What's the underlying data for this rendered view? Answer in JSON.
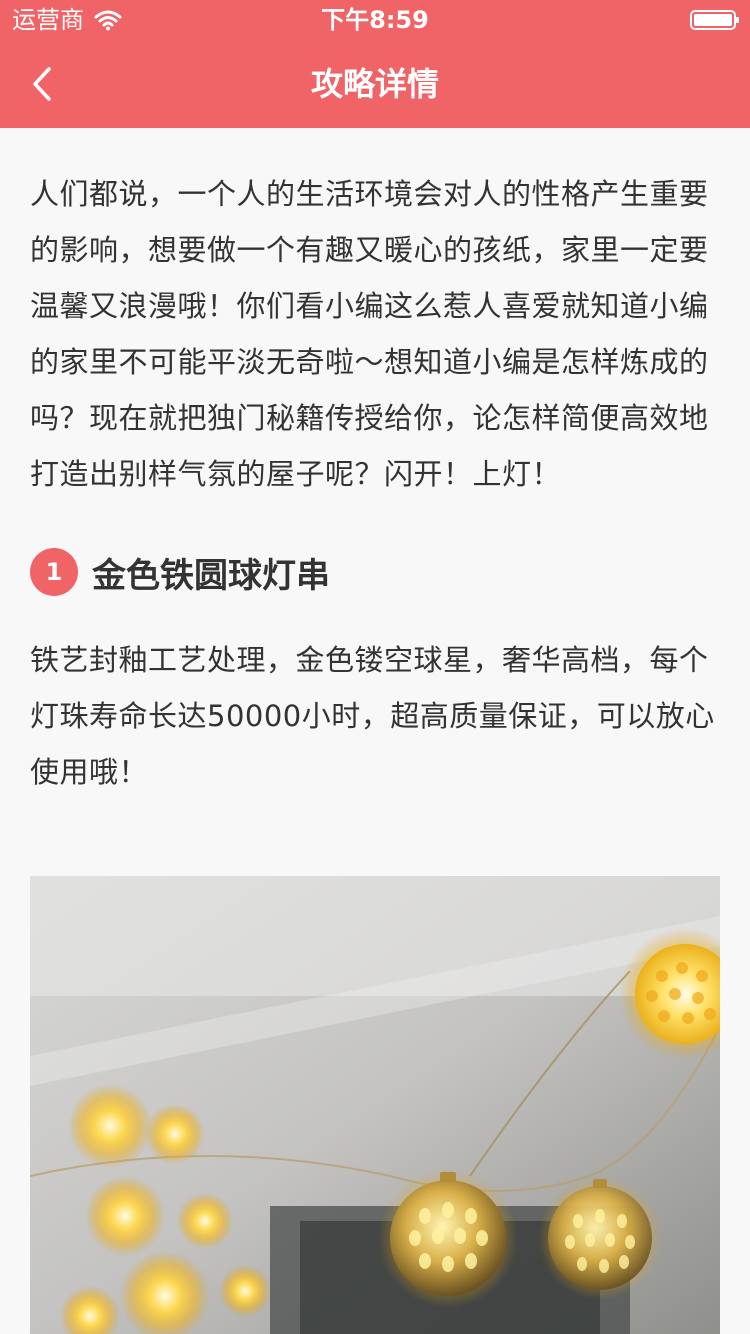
{
  "status_bar": {
    "carrier": "运营商",
    "time": "下午8:59"
  },
  "nav": {
    "title": "攻略详情"
  },
  "article": {
    "intro": "人们都说，一个人的生活环境会对人的性格产生重要的影响，想要做一个有趣又暖心的孩纸，家里一定要温馨又浪漫哦！你们看小编这么惹人喜爱就知道小编的家里不可能平淡无奇啦～想知道小编是怎样炼成的吗？现在就把独门秘籍传授给你，论怎样简便高效地打造出别样气氛的屋子呢？闪开！上灯！",
    "sections": [
      {
        "number": "1",
        "title": "金色铁圆球灯串",
        "description": "铁艺封釉工艺处理，金色镂空球星，奢华高档，每个灯珠寿命长达50000小时，超高质量保证，可以放心使用哦！"
      }
    ]
  },
  "colors": {
    "accent": "#f06467",
    "text": "#333333",
    "background": "#f8f8f8"
  },
  "icons": {
    "back": "chevron-left-icon",
    "wifi": "wifi-icon",
    "battery": "battery-icon"
  }
}
